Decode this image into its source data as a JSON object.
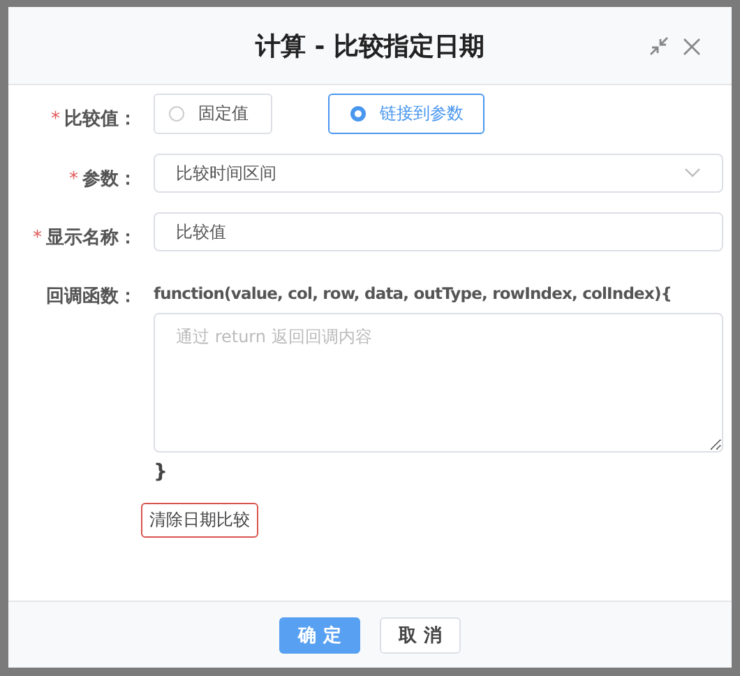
{
  "dialog": {
    "title": "计算 - 比较指定日期"
  },
  "fields": [
    {
      "kind": "radio",
      "label": "比较值：",
      "required_mark": "*",
      "options": [
        {
          "label": "固定值",
          "selected": false
        },
        {
          "label": "链接到参数",
          "selected": true
        }
      ]
    },
    {
      "kind": "select",
      "label": "参数：",
      "required_mark": "*",
      "value": "比较时间区间"
    },
    {
      "kind": "input",
      "label": "显示名称：",
      "required_mark": "*",
      "value": "比较值"
    },
    {
      "kind": "callback",
      "label": "回调函数：",
      "signature": "function(value, col, row, data, outType, rowIndex, colIndex){",
      "placeholder": "通过 return 返回回调内容",
      "closing": "}"
    }
  ],
  "clear_button": "清除日期比较",
  "buttons": [
    {
      "label": "确 定",
      "kind": "primary"
    },
    {
      "label": "取 消",
      "kind": "default"
    }
  ]
}
